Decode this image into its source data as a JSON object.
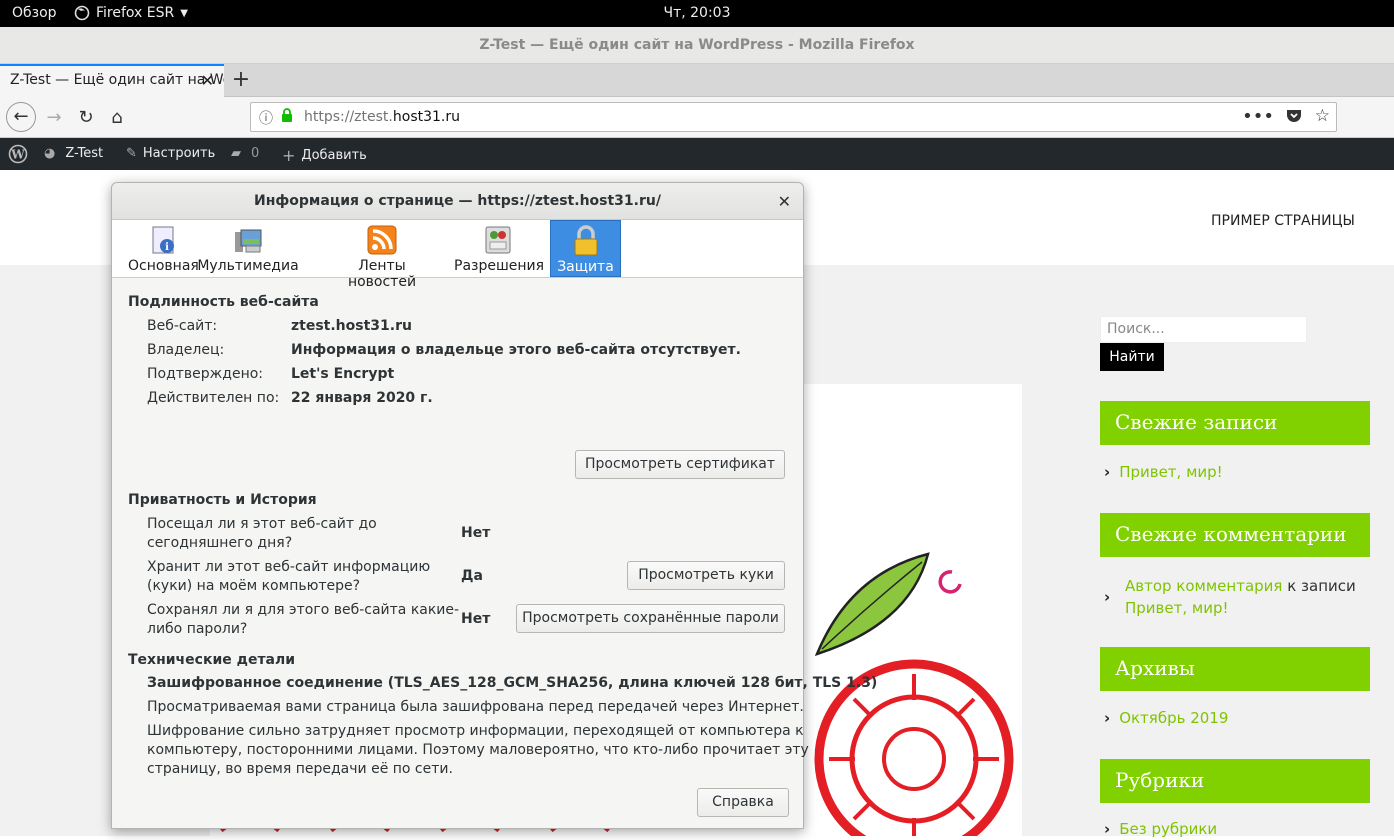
{
  "gnome": {
    "overview": "Обзор",
    "app": "Firefox ESR",
    "clock": "Чт, 20:03"
  },
  "window": {
    "title": "Z-Test — Ещё один сайт на WordPress - Mozilla Firefox"
  },
  "tab": {
    "title": "Z-Test — Ещё один сайт на WordPress"
  },
  "nav": {
    "url_prefix": "https://ztest.",
    "url_domain": "host31.ru"
  },
  "wpbar": {
    "site": "Z-Test",
    "customize": "Настроить",
    "comments": "0",
    "add": "Добавить"
  },
  "page": {
    "menu_item": "ПРИМЕР СТРАНИЦЫ",
    "search_placeholder": "Поиск...",
    "search_button": "Найти",
    "widgets": {
      "recent_posts": {
        "title": "Свежие записи",
        "link": "Привет, мир!"
      },
      "recent_comments": {
        "title": "Свежие комментарии",
        "author": "Автор комментария",
        "mid": "к записи",
        "post": "Привет, мир!"
      },
      "archives": {
        "title": "Архивы",
        "link": "Октябрь 2019"
      },
      "categories": {
        "title": "Рубрики",
        "link": "Без рубрики"
      }
    }
  },
  "dialog": {
    "title": "Информация о странице — https://ztest.host31.ru/",
    "tabs": [
      "Основная",
      "Мультимедиа",
      "Ленты новостей",
      "Разрешения",
      "Защита"
    ],
    "identity": {
      "heading": "Подлинность веб-сайта",
      "website_label": "Веб-сайт:",
      "website": "ztest.host31.ru",
      "owner_label": "Владелец:",
      "owner": "Информация о владельце этого веб-сайта отсутствует.",
      "verified_label": "Подтверждено:",
      "verified": "Let's Encrypt",
      "expires_label": "Действителен по:",
      "expires": "22 января 2020 г.",
      "view_cert": "Просмотреть сертификат"
    },
    "privacy": {
      "heading": "Приватность и История",
      "q1a": "Посещал ли я этот веб-сайт до",
      "q1b": "сегодняшнего дня?",
      "a1": "Нет",
      "q2a": "Хранит ли этот веб-сайт информацию",
      "q2b": "(куки) на моём компьютере?",
      "a2": "Да",
      "q3a": "Сохранял ли я для этого веб-сайта какие-",
      "q3b": "либо пароли?",
      "a3": "Нет",
      "view_cookies": "Просмотреть куки",
      "view_passwords": "Просмотреть сохранённые пароли"
    },
    "tech": {
      "heading": "Технические детали",
      "conn": "Зашифрованное соединение (TLS_AES_128_GCM_SHA256, длина ключей 128 бит, TLS 1.3)",
      "l1": "Просматриваемая вами страница была зашифрована перед передачей через Интернет.",
      "l2": "Шифрование сильно затрудняет просмотр информации, переходящей от компьютера к",
      "l3": "компьютеру, посторонними лицами. Поэтому маловероятно, что кто-либо прочитает эту",
      "l4": "страницу, во время передачи её по сети."
    },
    "help": "Справка"
  },
  "colors": {
    "accent_green": "#81d100",
    "wp_bar": "#23282d",
    "selected_tab": "#3d8ee3"
  }
}
